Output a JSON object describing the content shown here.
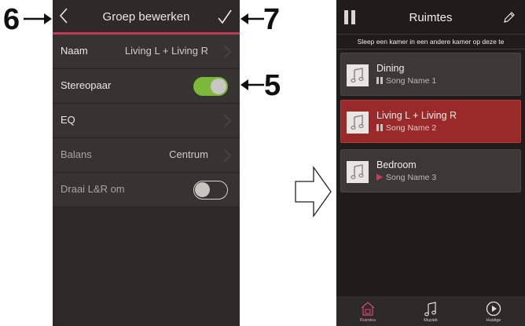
{
  "callouts": {
    "six": "6",
    "seven": "7",
    "five": "5"
  },
  "left_screen": {
    "header": {
      "title": "Groep bewerken",
      "back_icon": "chevron-left-icon",
      "confirm_icon": "checkmark-icon"
    },
    "rows": [
      {
        "label": "Naam",
        "value": "Living L + Living R"
      },
      {
        "label": "Stereopaar",
        "toggle": "on"
      },
      {
        "label": "EQ"
      },
      {
        "label": "Balans",
        "value": "Centrum"
      },
      {
        "label": "Draai L&R om",
        "toggle": "off"
      }
    ],
    "colors": {
      "background": "#2d2b29",
      "row": "#363432",
      "accent_line": "#c23a55",
      "toggle_on": "#7cb83a"
    }
  },
  "right_screen": {
    "header": {
      "title": "Ruimtes",
      "left_icon": "pause-icon",
      "right_icon": "pencil-icon"
    },
    "instruction": "Sleep een kamer in een andere kamer op deze te",
    "rooms": [
      {
        "name": "Dining",
        "song": "Song Name 1",
        "status": "paused"
      },
      {
        "name": "Living L + Living R",
        "song": "Song Name 2",
        "status": "paused",
        "selected": true
      },
      {
        "name": "Bedroom",
        "song": "Song Name 3",
        "status": "playing"
      }
    ],
    "tabs": [
      {
        "label": "Ruimtes",
        "icon": "house-icon",
        "active": true
      },
      {
        "label": "Muziek",
        "icon": "music-note-icon"
      },
      {
        "label": "Huidige",
        "icon": "play-circle-icon"
      }
    ],
    "colors": {
      "background": "#1e1d1c",
      "selected_room": "#9a2a2a",
      "play_indicator": "#d6335a"
    }
  }
}
